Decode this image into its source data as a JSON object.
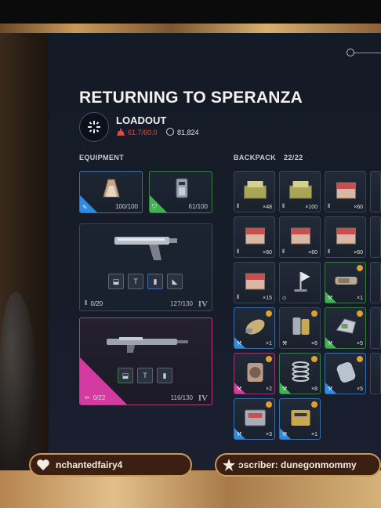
{
  "title": "RETURNING TO SPERANZA",
  "loadout": {
    "label": "LOADOUT",
    "weight": "61.7/60.0",
    "currency": "81,824"
  },
  "equipment": {
    "label": "EQUIPMENT",
    "slots": [
      {
        "name": "augment",
        "count": "100/100",
        "rarity": "blue"
      },
      {
        "name": "shield",
        "count": "61/100",
        "rarity": "green"
      }
    ],
    "weapons": [
      {
        "ammo": "0/20",
        "durability": "127/130",
        "tier": "IV",
        "rarity": "common"
      },
      {
        "ammo": "0/22",
        "durability": "116/130",
        "tier": "IV",
        "rarity": "epic"
      }
    ]
  },
  "backpack": {
    "label": "BACKPACK",
    "capacity": "22/22",
    "items": [
      {
        "qty": "×48",
        "type": "ammo",
        "rarity": "common",
        "kind": "ammo-box"
      },
      {
        "qty": "×100",
        "type": "ammo",
        "rarity": "common",
        "kind": "ammo-box"
      },
      {
        "qty": "×60",
        "type": "ammo",
        "rarity": "common",
        "kind": "shell-box"
      },
      {
        "qty": "×60",
        "type": "ammo",
        "rarity": "common",
        "kind": "shell-box"
      },
      {
        "qty": "×60",
        "type": "ammo",
        "rarity": "common",
        "kind": "shell-box"
      },
      {
        "qty": "×60",
        "type": "ammo",
        "rarity": "common",
        "kind": "shell-box"
      },
      {
        "qty": "×15",
        "type": "ammo",
        "rarity": "common",
        "kind": "shell-box"
      },
      {
        "qty": "",
        "type": "gadget",
        "rarity": "common",
        "kind": "flag"
      },
      {
        "qty": "×1",
        "type": "mod",
        "rarity": "green",
        "kind": "barrel",
        "marked": true
      },
      {
        "qty": "×1",
        "type": "mod",
        "rarity": "blue",
        "kind": "grenade",
        "marked": true
      },
      {
        "qty": "×6",
        "type": "mod",
        "rarity": "common",
        "kind": "canister",
        "marked": true
      },
      {
        "qty": "×5",
        "type": "mod",
        "rarity": "green",
        "kind": "part",
        "marked": true
      },
      {
        "qty": "×2",
        "type": "mod",
        "rarity": "pink",
        "kind": "device",
        "marked": true
      },
      {
        "qty": "×8",
        "type": "mod",
        "rarity": "green",
        "kind": "spring",
        "marked": true
      },
      {
        "qty": "×5",
        "type": "mod",
        "rarity": "blue",
        "kind": "cell",
        "marked": true
      },
      {
        "qty": "×3",
        "type": "mod",
        "rarity": "blue",
        "kind": "case",
        "marked": true
      },
      {
        "qty": "×1",
        "type": "mod",
        "rarity": "blue",
        "kind": "battery",
        "marked": true
      }
    ]
  },
  "chat": {
    "left_name": "nchantedfairy4",
    "right_text": "ɔscriber: dunegonmommy"
  },
  "colors": {
    "accent_red": "#e04a4a",
    "rarity_blue": "#2f8be0",
    "rarity_green": "#3db450",
    "rarity_pink": "#d43aa0",
    "marker_gold": "#e0a030"
  }
}
